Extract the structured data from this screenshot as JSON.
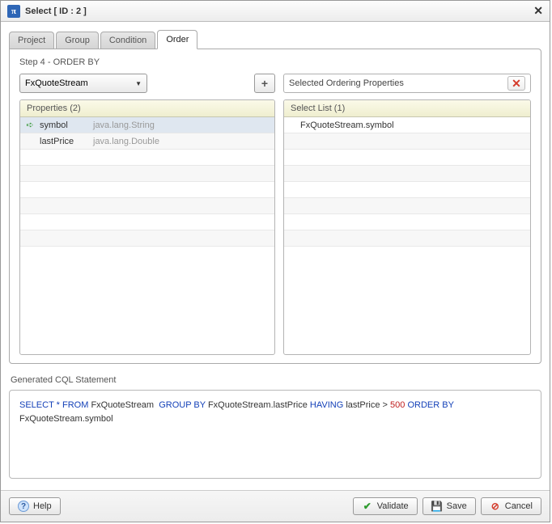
{
  "window": {
    "title": "Select [ ID : 2 ]"
  },
  "tabs": [
    {
      "label": "Project"
    },
    {
      "label": "Group"
    },
    {
      "label": "Condition"
    },
    {
      "label": "Order",
      "active": true
    }
  ],
  "step": {
    "label": "Step 4 - ORDER BY"
  },
  "source": {
    "selected": "FxQuoteStream"
  },
  "properties": {
    "header": "Properties (2)",
    "rows": [
      {
        "name": "symbol",
        "type": "java.lang.String",
        "selected": true
      },
      {
        "name": "lastPrice",
        "type": "java.lang.Double",
        "selected": false
      }
    ]
  },
  "ordering": {
    "title": "Selected Ordering Properties",
    "list_header": "Select List (1)",
    "items": [
      {
        "label": "FxQuoteStream.symbol"
      }
    ]
  },
  "cql": {
    "label": "Generated CQL Statement",
    "tokens": {
      "select": "SELECT",
      "star_from": "* FROM",
      "src": "FxQuoteStream",
      "group_by": "GROUP BY",
      "grp_field": "FxQuoteStream.lastPrice",
      "having": "HAVING",
      "hav_cond": "lastPrice >",
      "hav_val": "500",
      "order_by": "ORDER BY",
      "order_field": "FxQuoteStream.symbol"
    }
  },
  "buttons": {
    "help": "Help",
    "validate": "Validate",
    "save": "Save",
    "cancel": "Cancel",
    "add": "+",
    "remove": "✕"
  }
}
